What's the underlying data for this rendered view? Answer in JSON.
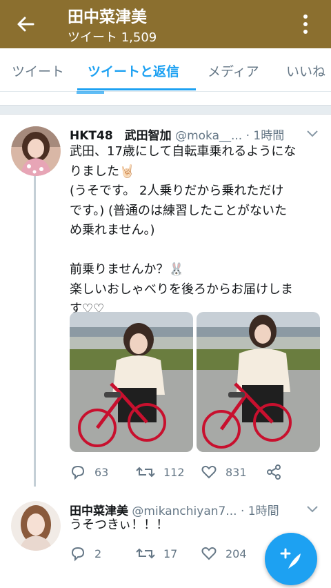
{
  "header": {
    "title": "田中菜津美",
    "subtitle": "ツイート 1,509"
  },
  "tabs": [
    {
      "label": "ツイート",
      "active": false
    },
    {
      "label": "ツイートと返信",
      "active": true
    },
    {
      "label": "メディア",
      "active": false
    },
    {
      "label": "いいね",
      "active": false
    }
  ],
  "tweet1": {
    "name": "HKT48　武田智加",
    "handle": "@moka__...",
    "time": "· 1時間",
    "lines": [
      "武田、17歳にして自転車乗れるようにな",
      "りました🤘🏻",
      "(うそです。 2人乗りだから乗れただけ",
      "です。) (普通のは練習したことがないた",
      "め乗れません。)",
      "",
      "前乗りませんか？🐰",
      "楽しいおしゃべりを後ろからお届けしま",
      "す♡♡"
    ],
    "replies": "63",
    "retweets": "112",
    "likes": "831"
  },
  "tweet2": {
    "name": "田中菜津美",
    "handle": "@mikanchiyan7...",
    "time": "· 1時間",
    "lines": [
      "うそつきぃ！！！"
    ],
    "replies": "2",
    "retweets": "17",
    "likes": "204"
  },
  "colors": {
    "header_bg": "#8b6f2f",
    "accent": "#1da1f2",
    "muted": "#657786"
  },
  "icons": {
    "back": "arrow-left-icon",
    "more": "more-vertical-icon",
    "reply": "comment-icon",
    "retweet": "retweet-icon",
    "like": "heart-icon",
    "share": "share-icon",
    "compose": "compose-tweet-icon"
  }
}
